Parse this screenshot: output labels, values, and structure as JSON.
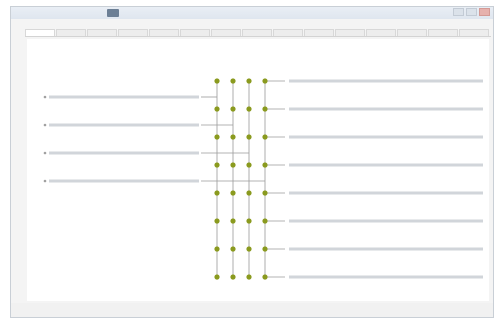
{
  "window": {
    "title": ""
  },
  "menu": {
    "items": [
      "",
      "",
      "",
      "",
      ""
    ]
  },
  "tabs": [
    "",
    "",
    "",
    "",
    "",
    "",
    "",
    "",
    "",
    "",
    "",
    "",
    "",
    "",
    ""
  ],
  "left_rows": [
    {
      "label": ""
    },
    {
      "label": ""
    },
    {
      "label": ""
    },
    {
      "label": ""
    }
  ],
  "right_rows": [
    {
      "label": ""
    },
    {
      "label": ""
    },
    {
      "label": ""
    },
    {
      "label": ""
    },
    {
      "label": ""
    },
    {
      "label": ""
    },
    {
      "label": ""
    },
    {
      "label": ""
    }
  ],
  "status": [
    "",
    "",
    "",
    ""
  ],
  "colors": {
    "node": "#8a9a1e",
    "line": "#9a9a9a",
    "text_line": "#b9bec6"
  }
}
